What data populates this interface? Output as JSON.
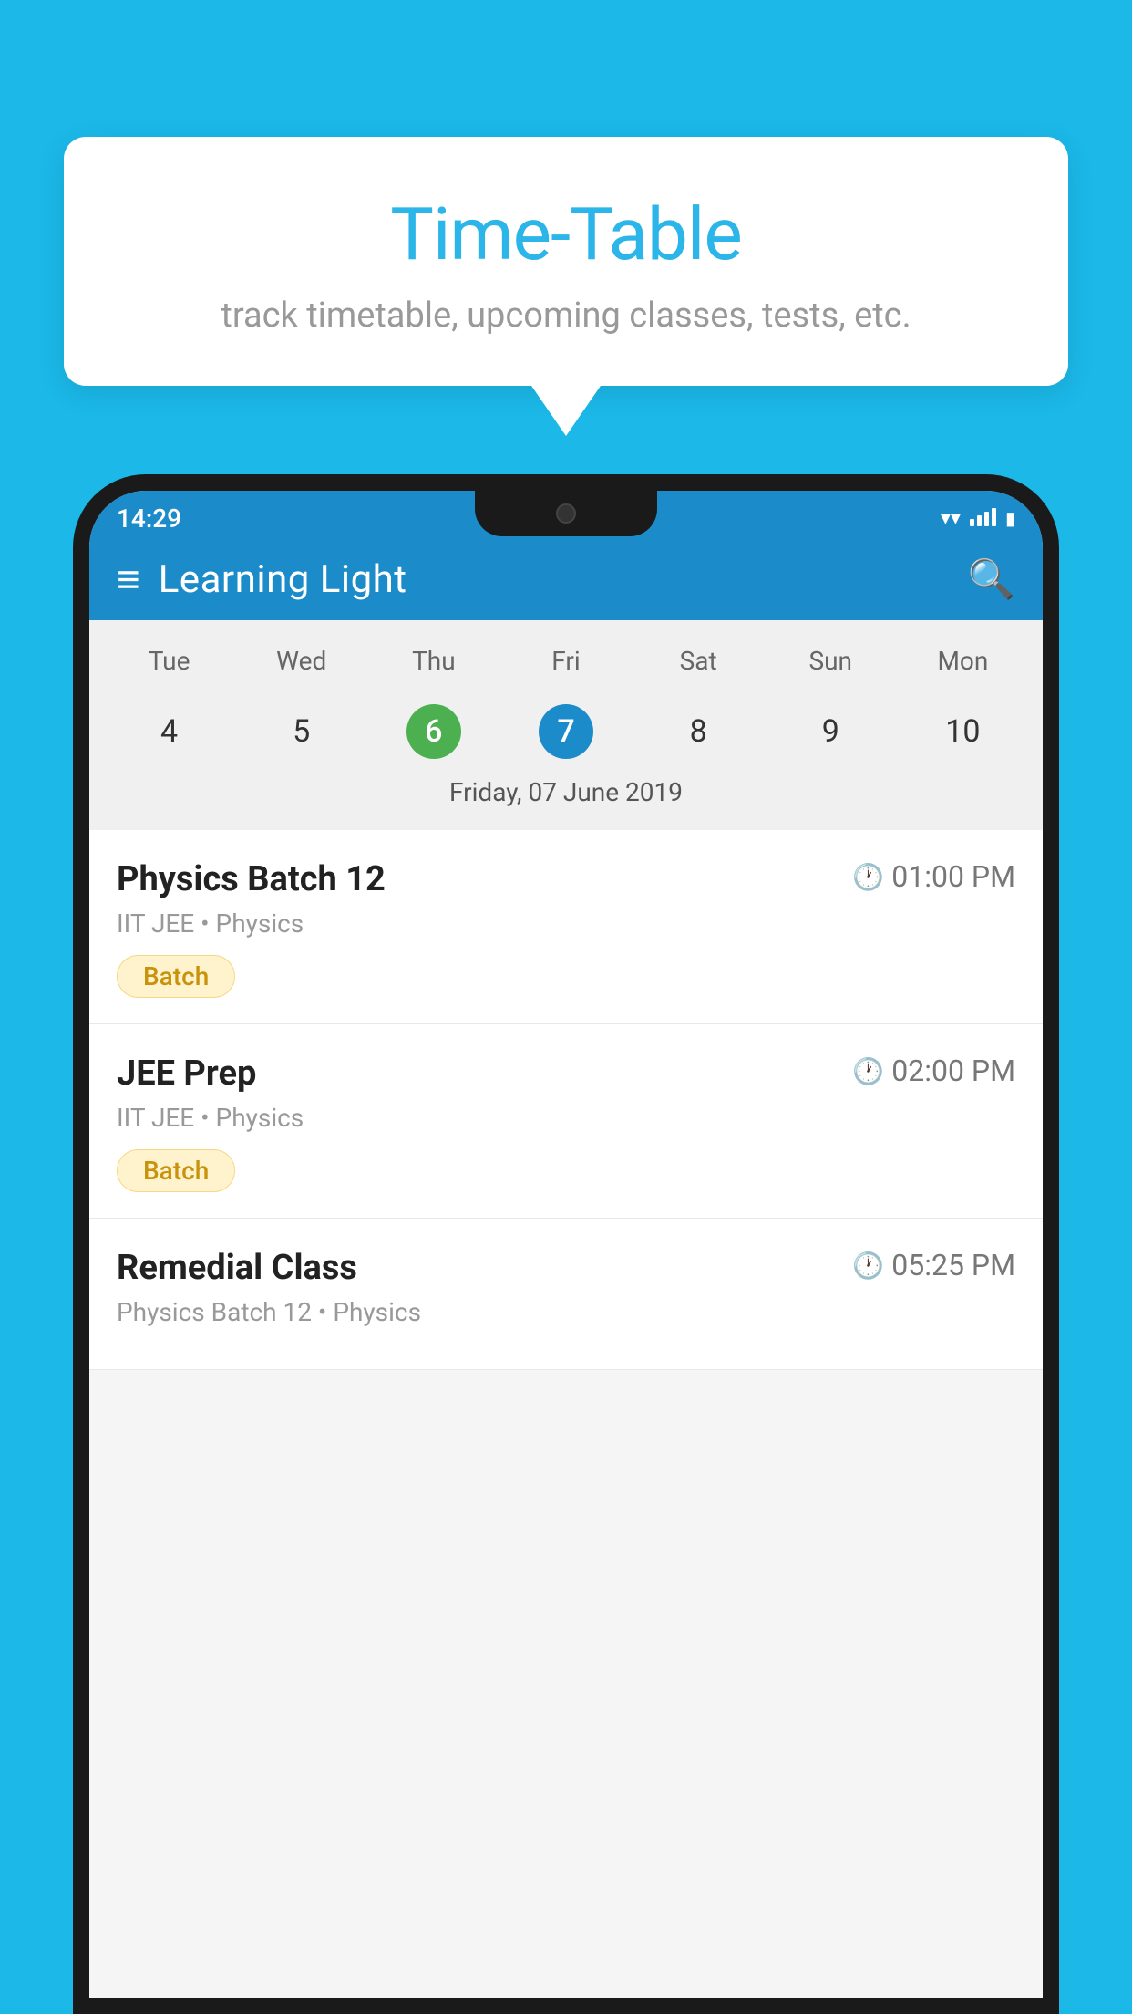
{
  "background_color": "#1BB8E8",
  "bubble": {
    "title": "Time-Table",
    "subtitle": "track timetable, upcoming classes, tests, etc."
  },
  "phone": {
    "status_bar": {
      "time": "14:29"
    },
    "app_bar": {
      "title": "Learning Light"
    },
    "calendar": {
      "days": [
        "Tue",
        "Wed",
        "Thu",
        "Fri",
        "Sat",
        "Sun",
        "Mon"
      ],
      "dates": [
        "4",
        "5",
        "6",
        "7",
        "8",
        "9",
        "10"
      ],
      "today_index": 2,
      "selected_index": 3,
      "selected_label": "Friday, 07 June 2019"
    },
    "classes": [
      {
        "name": "Physics Batch 12",
        "time": "01:00 PM",
        "meta": "IIT JEE • Physics",
        "badge": "Batch"
      },
      {
        "name": "JEE Prep",
        "time": "02:00 PM",
        "meta": "IIT JEE • Physics",
        "badge": "Batch"
      },
      {
        "name": "Remedial Class",
        "time": "05:25 PM",
        "meta": "Physics Batch 12 • Physics",
        "badge": ""
      }
    ]
  }
}
